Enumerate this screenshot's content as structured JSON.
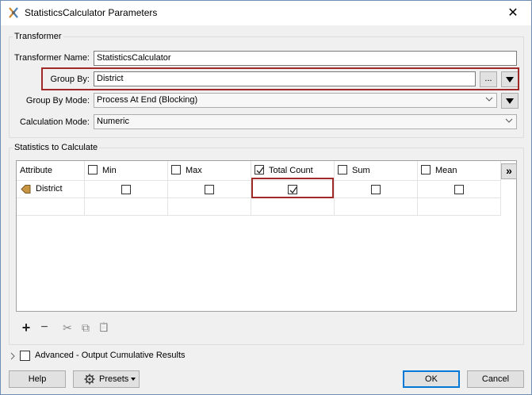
{
  "window": {
    "title": "StatisticsCalculator Parameters",
    "close_glyph": "✕"
  },
  "transformer": {
    "group_title": "Transformer",
    "name_label": "Transformer Name:",
    "name_value": "StatisticsCalculator",
    "group_by_label": "Group By:",
    "group_by_value": "District",
    "ellipsis_label": "...",
    "group_by_mode_label": "Group By Mode:",
    "group_by_mode_value": "Process At End (Blocking)",
    "calc_mode_label": "Calculation Mode:",
    "calc_mode_value": "Numeric"
  },
  "statistics": {
    "group_title": "Statistics to Calculate",
    "columns": [
      "Attribute",
      "Min",
      "Max",
      "Total Count",
      "Sum",
      "Mean"
    ],
    "header_checked": [
      false,
      false,
      true,
      false,
      false
    ],
    "more_glyph": "»",
    "rows": [
      {
        "attribute": "District",
        "checks": [
          false,
          false,
          true,
          false,
          false
        ]
      }
    ]
  },
  "toolbar": {
    "add": "+",
    "remove": "−",
    "cut": "✂",
    "copy": "⧉",
    "paste": "📋"
  },
  "advanced": {
    "label": "Advanced - Output Cumulative Results",
    "checked": false
  },
  "footer": {
    "help": "Help",
    "presets": "Presets",
    "ok": "OK",
    "cancel": "Cancel"
  }
}
